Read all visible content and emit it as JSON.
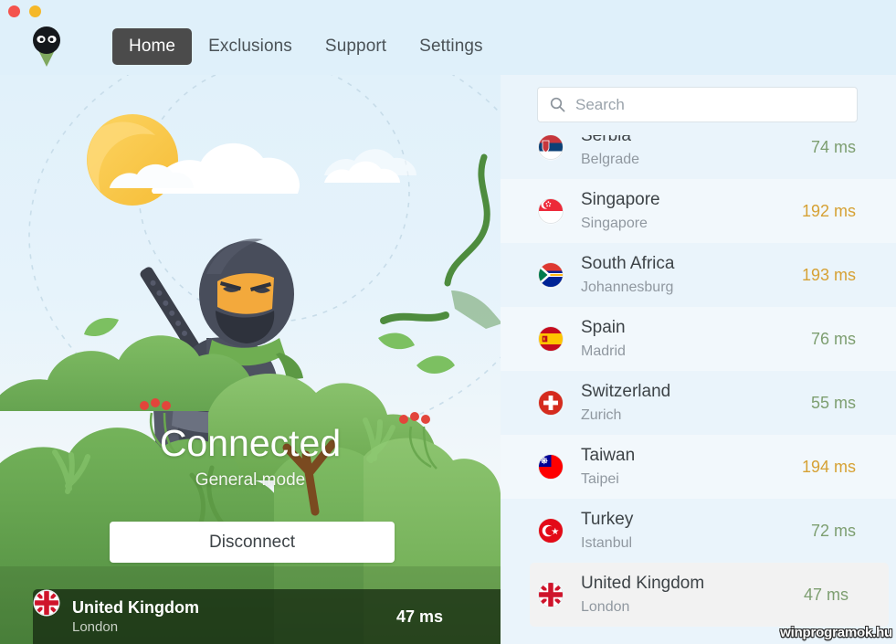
{
  "window": {
    "controls": [
      {
        "name": "close",
        "color": "#f4534d"
      },
      {
        "name": "minimize",
        "color": "#f5b829"
      }
    ]
  },
  "nav": {
    "logo_icon": "ninja-logo-icon",
    "items": [
      {
        "label": "Home",
        "active": true
      },
      {
        "label": "Exclusions",
        "active": false
      },
      {
        "label": "Support",
        "active": false
      },
      {
        "label": "Settings",
        "active": false
      }
    ]
  },
  "hero": {
    "status": "Connected",
    "mode": "General mode",
    "button_label": "Disconnect",
    "illustration": "ninja-hiding-in-bushes",
    "footer": {
      "flag_icon": "flag-united-kingdom",
      "country": "United Kingdom",
      "city": "London",
      "ping": "47 ms"
    }
  },
  "sidebar": {
    "search": {
      "icon": "search-icon",
      "placeholder": "Search",
      "value": ""
    },
    "locations": [
      {
        "flag_icon": "flag-serbia",
        "country": "Serbia",
        "city": "Belgrade",
        "ping": "74 ms",
        "speed": "good",
        "clipped": true,
        "selected": false
      },
      {
        "flag_icon": "flag-singapore",
        "country": "Singapore",
        "city": "Singapore",
        "ping": "192 ms",
        "speed": "slow",
        "clipped": false,
        "selected": false
      },
      {
        "flag_icon": "flag-south-africa",
        "country": "South Africa",
        "city": "Johannesburg",
        "ping": "193 ms",
        "speed": "slow",
        "clipped": false,
        "selected": false
      },
      {
        "flag_icon": "flag-spain",
        "country": "Spain",
        "city": "Madrid",
        "ping": "76 ms",
        "speed": "good",
        "clipped": false,
        "selected": false
      },
      {
        "flag_icon": "flag-switzerland",
        "country": "Switzerland",
        "city": "Zurich",
        "ping": "55 ms",
        "speed": "good",
        "clipped": false,
        "selected": false
      },
      {
        "flag_icon": "flag-taiwan",
        "country": "Taiwan",
        "city": "Taipei",
        "ping": "194 ms",
        "speed": "slow",
        "clipped": false,
        "selected": false
      },
      {
        "flag_icon": "flag-turkey",
        "country": "Turkey",
        "city": "Istanbul",
        "ping": "72 ms",
        "speed": "good",
        "clipped": false,
        "selected": false
      },
      {
        "flag_icon": "flag-united-kingdom",
        "country": "United Kingdom",
        "city": "London",
        "ping": "47 ms",
        "speed": "good",
        "clipped": false,
        "selected": true
      }
    ]
  },
  "watermark": "winprogramok.hu",
  "colors": {
    "app_background": "#dff0fa",
    "sidebar_background": "#eaf4fb",
    "active_tab": "#4b4b4b",
    "ping_good": "#7d9e70",
    "ping_slow": "#d6a134",
    "selected_row": "#f2f2f2"
  }
}
